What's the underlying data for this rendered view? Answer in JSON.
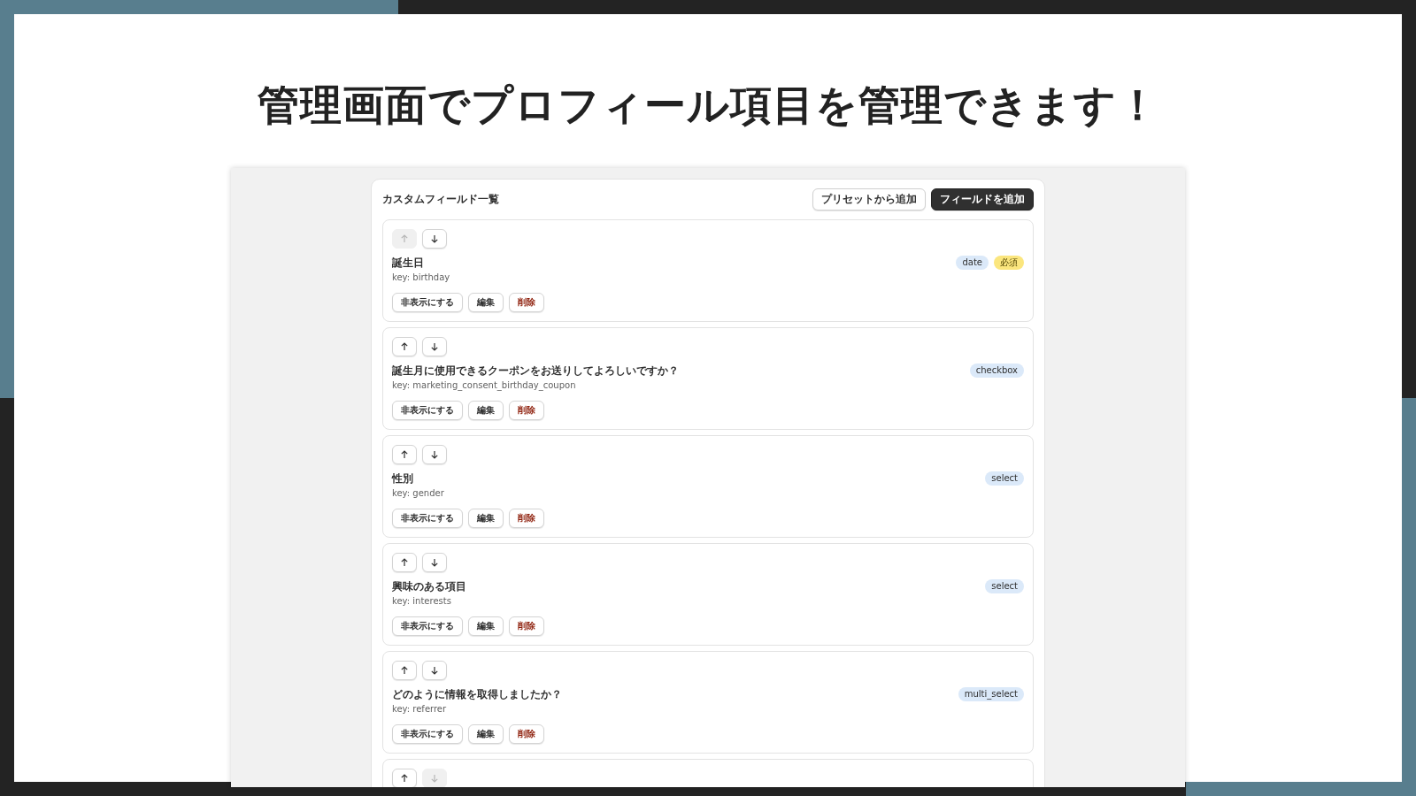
{
  "slide_title": "管理画面でプロフィール項目を管理できます！",
  "panel": {
    "title": "カスタムフィールド一覧",
    "buttons": [
      {
        "label": "プリセットから追加",
        "kind": "secondary"
      },
      {
        "label": "フィールドを追加",
        "kind": "primary"
      }
    ]
  },
  "fields": [
    {
      "up_disabled": true,
      "down_disabled": false,
      "name": "誕生日",
      "key": "key: birthday",
      "badges": [
        {
          "text": "date",
          "kind": "type"
        },
        {
          "text": "必須",
          "kind": "required"
        }
      ],
      "actions": [
        {
          "label": "非表示にする",
          "kind": "normal"
        },
        {
          "label": "編集",
          "kind": "normal"
        },
        {
          "label": "削除",
          "kind": "danger"
        }
      ]
    },
    {
      "up_disabled": false,
      "down_disabled": false,
      "name": "誕生月に使用できるクーポンをお送りしてよろしいですか？",
      "key": "key: marketing_consent_birthday_coupon",
      "badges": [
        {
          "text": "checkbox",
          "kind": "type"
        }
      ],
      "actions": [
        {
          "label": "非表示にする",
          "kind": "normal"
        },
        {
          "label": "編集",
          "kind": "normal"
        },
        {
          "label": "削除",
          "kind": "danger"
        }
      ]
    },
    {
      "up_disabled": false,
      "down_disabled": false,
      "name": "性別",
      "key": "key: gender",
      "badges": [
        {
          "text": "select",
          "kind": "type"
        }
      ],
      "actions": [
        {
          "label": "非表示にする",
          "kind": "normal"
        },
        {
          "label": "編集",
          "kind": "normal"
        },
        {
          "label": "削除",
          "kind": "danger"
        }
      ]
    },
    {
      "up_disabled": false,
      "down_disabled": false,
      "name": "興味のある項目",
      "key": "key: interests",
      "badges": [
        {
          "text": "select",
          "kind": "type"
        }
      ],
      "actions": [
        {
          "label": "非表示にする",
          "kind": "normal"
        },
        {
          "label": "編集",
          "kind": "normal"
        },
        {
          "label": "削除",
          "kind": "danger"
        }
      ]
    },
    {
      "up_disabled": false,
      "down_disabled": false,
      "name": "どのように情報を取得しましたか？",
      "key": "key: referrer",
      "badges": [
        {
          "text": "multi_select",
          "kind": "type"
        }
      ],
      "actions": [
        {
          "label": "非表示にする",
          "kind": "normal"
        },
        {
          "label": "編集",
          "kind": "normal"
        },
        {
          "label": "削除",
          "kind": "danger"
        }
      ]
    },
    {
      "up_disabled": false,
      "down_disabled": true
    }
  ]
}
